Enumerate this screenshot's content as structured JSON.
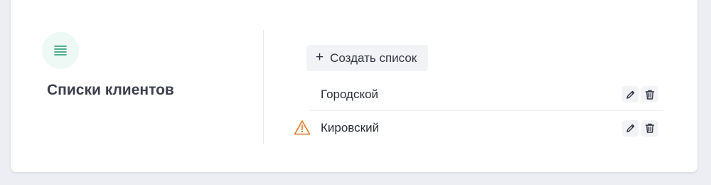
{
  "panel": {
    "section_icon": "list-icon",
    "title": "Списки клиентов"
  },
  "lists": {
    "create_button": {
      "icon": "plus-icon",
      "symbol": "+",
      "label": "Создать список"
    },
    "items": [
      {
        "name": "Городской",
        "warning": false,
        "actions": [
          "edit-icon",
          "trash-icon"
        ]
      },
      {
        "name": "Кировский",
        "warning": true,
        "actions": [
          "edit-icon",
          "trash-icon"
        ]
      }
    ]
  },
  "colors": {
    "page_background": "#eceef3",
    "card_background": "#ffffff",
    "accent_green": "#3aa37f",
    "warning_orange": "#e07a2e",
    "button_background": "#f1f3f6",
    "text": "#2b2f38"
  }
}
